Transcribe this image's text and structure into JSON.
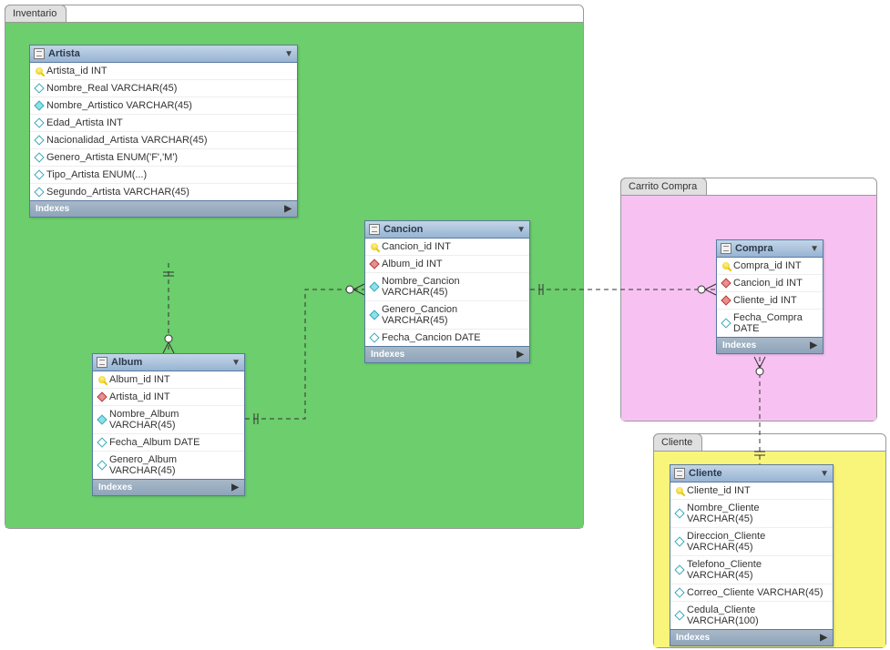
{
  "regions": {
    "inventario": {
      "label": "Inventario",
      "color": "#6cce6c"
    },
    "carrito": {
      "label": "Carrito Compra",
      "color": "#f7c2f2"
    },
    "cliente": {
      "label": "Cliente",
      "color": "#f9f57a"
    }
  },
  "tables": {
    "artista": {
      "name": "Artista",
      "indexes_label": "Indexes",
      "cols": [
        {
          "icon": "key",
          "text": "Artista_id INT"
        },
        {
          "icon": "diamond",
          "text": "Nombre_Real VARCHAR(45)"
        },
        {
          "icon": "diamond-cyan",
          "text": "Nombre_Artistico VARCHAR(45)"
        },
        {
          "icon": "diamond",
          "text": "Edad_Artista INT"
        },
        {
          "icon": "diamond",
          "text": "Nacionalidad_Artista VARCHAR(45)"
        },
        {
          "icon": "diamond",
          "text": "Genero_Artista ENUM('F','M')"
        },
        {
          "icon": "diamond",
          "text": "Tipo_Artista ENUM(...)"
        },
        {
          "icon": "diamond",
          "text": "Segundo_Artista VARCHAR(45)"
        }
      ]
    },
    "album": {
      "name": "Album",
      "indexes_label": "Indexes",
      "cols": [
        {
          "icon": "key",
          "text": "Album_id INT"
        },
        {
          "icon": "diamond-red",
          "text": "Artista_id INT"
        },
        {
          "icon": "diamond-cyan",
          "text": "Nombre_Album VARCHAR(45)"
        },
        {
          "icon": "diamond",
          "text": "Fecha_Album DATE"
        },
        {
          "icon": "diamond",
          "text": "Genero_Album VARCHAR(45)"
        }
      ]
    },
    "cancion": {
      "name": "Cancion",
      "indexes_label": "Indexes",
      "cols": [
        {
          "icon": "key",
          "text": "Cancion_id INT"
        },
        {
          "icon": "diamond-red",
          "text": "Album_id INT"
        },
        {
          "icon": "diamond-cyan",
          "text": "Nombre_Cancion VARCHAR(45)"
        },
        {
          "icon": "diamond-cyan",
          "text": "Genero_Cancion VARCHAR(45)"
        },
        {
          "icon": "diamond",
          "text": "Fecha_Cancion DATE"
        }
      ]
    },
    "compra": {
      "name": "Compra",
      "indexes_label": "Indexes",
      "cols": [
        {
          "icon": "key",
          "text": "Compra_id INT"
        },
        {
          "icon": "diamond-red",
          "text": "Cancion_id INT"
        },
        {
          "icon": "diamond-red",
          "text": "Cliente_id INT"
        },
        {
          "icon": "diamond",
          "text": "Fecha_Compra DATE"
        }
      ]
    },
    "cliente": {
      "name": "Cliente",
      "indexes_label": "Indexes",
      "cols": [
        {
          "icon": "key",
          "text": "Cliente_id INT"
        },
        {
          "icon": "diamond",
          "text": "Nombre_Cliente VARCHAR(45)"
        },
        {
          "icon": "diamond",
          "text": "Direccion_Cliente VARCHAR(45)"
        },
        {
          "icon": "diamond",
          "text": "Telefono_Cliente VARCHAR(45)"
        },
        {
          "icon": "diamond",
          "text": "Correo_Cliente VARCHAR(45)"
        },
        {
          "icon": "diamond",
          "text": "Cedula_Cliente VARCHAR(100)"
        }
      ]
    }
  },
  "chart_data": {
    "type": "er-diagram",
    "regions": [
      {
        "name": "Inventario",
        "tables": [
          "Artista",
          "Album",
          "Cancion"
        ]
      },
      {
        "name": "Carrito Compra",
        "tables": [
          "Compra"
        ]
      },
      {
        "name": "Cliente",
        "tables": [
          "Cliente"
        ]
      }
    ],
    "tables": {
      "Artista": {
        "pk": [
          "Artista_id"
        ],
        "columns": [
          "Artista_id INT",
          "Nombre_Real VARCHAR(45)",
          "Nombre_Artistico VARCHAR(45)",
          "Edad_Artista INT",
          "Nacionalidad_Artista VARCHAR(45)",
          "Genero_Artista ENUM('F','M')",
          "Tipo_Artista ENUM(...)",
          "Segundo_Artista VARCHAR(45)"
        ]
      },
      "Album": {
        "pk": [
          "Album_id"
        ],
        "fk": [
          "Artista_id"
        ],
        "columns": [
          "Album_id INT",
          "Artista_id INT",
          "Nombre_Album VARCHAR(45)",
          "Fecha_Album DATE",
          "Genero_Album VARCHAR(45)"
        ]
      },
      "Cancion": {
        "pk": [
          "Cancion_id"
        ],
        "fk": [
          "Album_id"
        ],
        "columns": [
          "Cancion_id INT",
          "Album_id INT",
          "Nombre_Cancion VARCHAR(45)",
          "Genero_Cancion VARCHAR(45)",
          "Fecha_Cancion DATE"
        ]
      },
      "Compra": {
        "pk": [
          "Compra_id"
        ],
        "fk": [
          "Cancion_id",
          "Cliente_id"
        ],
        "columns": [
          "Compra_id INT",
          "Cancion_id INT",
          "Cliente_id INT",
          "Fecha_Compra DATE"
        ]
      },
      "Cliente": {
        "pk": [
          "Cliente_id"
        ],
        "columns": [
          "Cliente_id INT",
          "Nombre_Cliente VARCHAR(45)",
          "Direccion_Cliente VARCHAR(45)",
          "Telefono_Cliente VARCHAR(45)",
          "Correo_Cliente VARCHAR(45)",
          "Cedula_Cliente VARCHAR(100)"
        ]
      }
    },
    "relationships": [
      {
        "from": "Artista",
        "to": "Album",
        "type": "1:N",
        "identifying": false
      },
      {
        "from": "Album",
        "to": "Cancion",
        "type": "1:N",
        "identifying": false
      },
      {
        "from": "Cancion",
        "to": "Compra",
        "type": "1:N",
        "identifying": false
      },
      {
        "from": "Cliente",
        "to": "Compra",
        "type": "1:N",
        "identifying": false
      }
    ]
  }
}
